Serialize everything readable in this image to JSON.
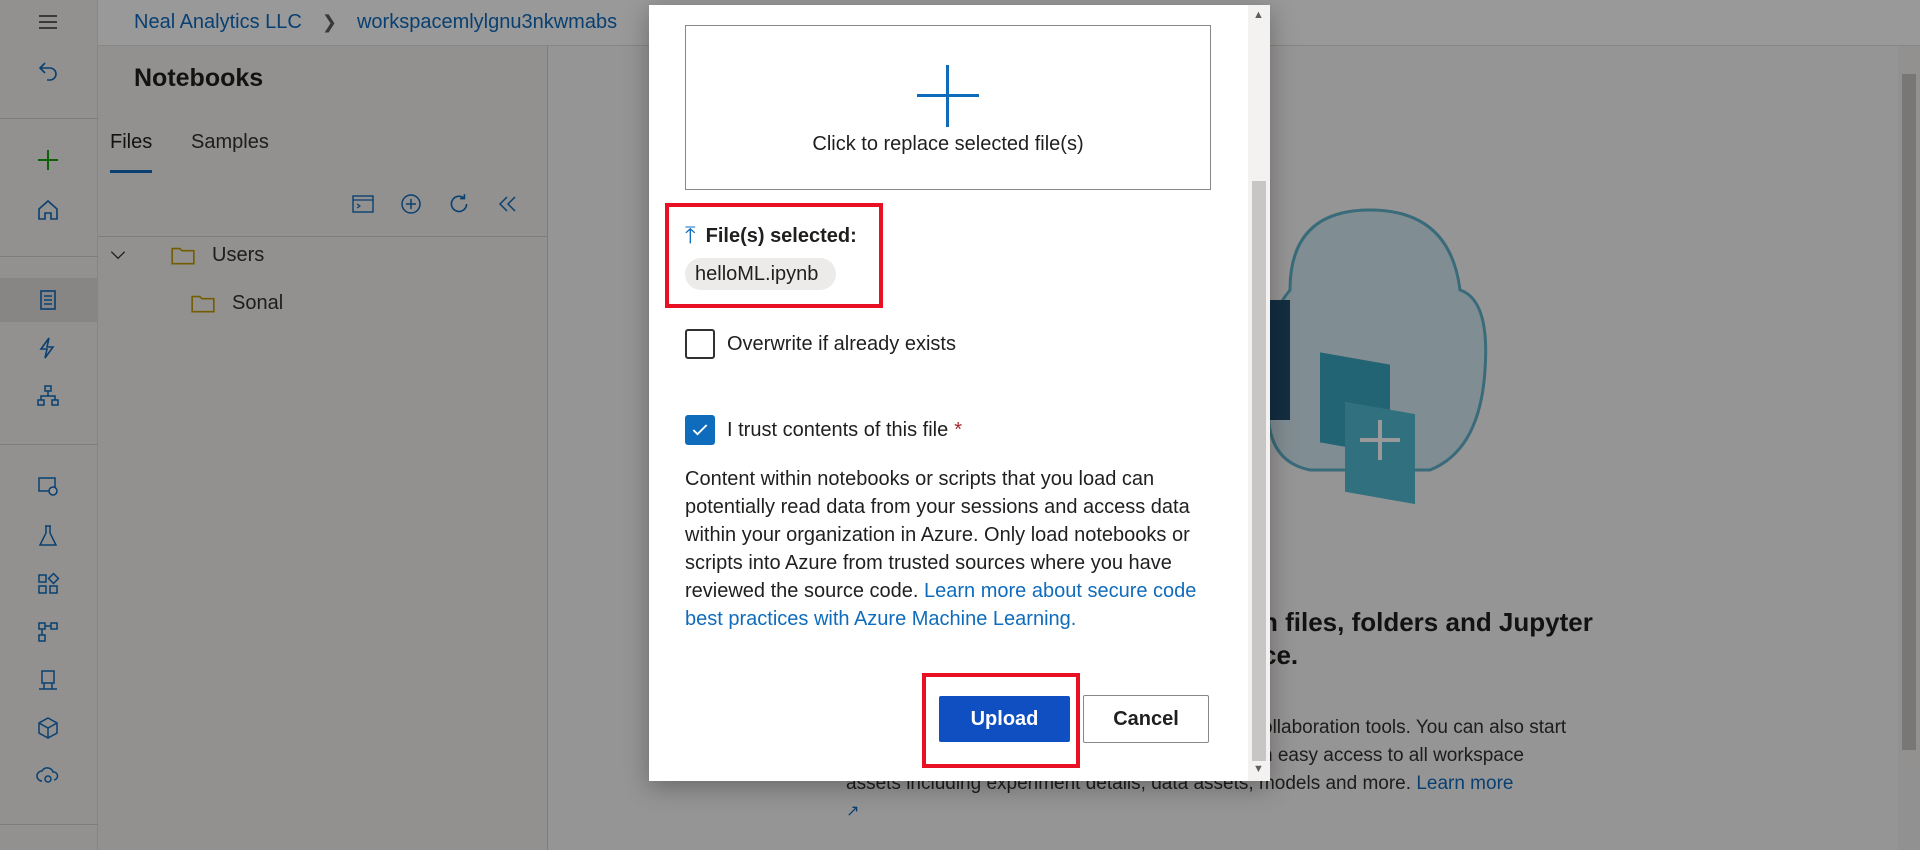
{
  "breadcrumb": {
    "org": "Neal Analytics LLC",
    "workspace": "workspacemlylgnu3nkwmabs"
  },
  "notebooks": {
    "title": "Notebooks",
    "tabs": [
      "Files",
      "Samples"
    ],
    "active_tab": "Files",
    "tree": [
      {
        "label": "Users",
        "level": 0,
        "expanded": true
      },
      {
        "label": "Sonal",
        "level": 1
      }
    ]
  },
  "background": {
    "heading_line1": "h files, folders and Jupyter",
    "heading_line2": "ce.",
    "para_line1": "ollaboration tools. You can also start",
    "para_line2": "h easy access to all workspace",
    "para_line3": "assets including experiment details, data assets, models and more.",
    "learn_more": "Learn more"
  },
  "dialog": {
    "dropzone_text": "Click to replace selected file(s)",
    "selected_label": "File(s) selected:",
    "selected_file": "helloML.ipynb",
    "overwrite_label": "Overwrite if already exists",
    "overwrite_checked": false,
    "trust_label": "I trust contents of this file",
    "trust_required_mark": "*",
    "trust_checked": true,
    "notice_text": "Content within notebooks or scripts that you load can potentially read data from your sessions and access data within your organization in Azure. Only load notebooks or scripts into Azure from trusted sources where you have reviewed the source code.",
    "notice_link": "Learn more about secure code best practices with Azure Machine Learning.",
    "upload_label": "Upload",
    "cancel_label": "Cancel"
  },
  "colors": {
    "accent": "#0f6cbd",
    "primary_button": "#0f4fc2",
    "highlight_box": "#e81123"
  }
}
